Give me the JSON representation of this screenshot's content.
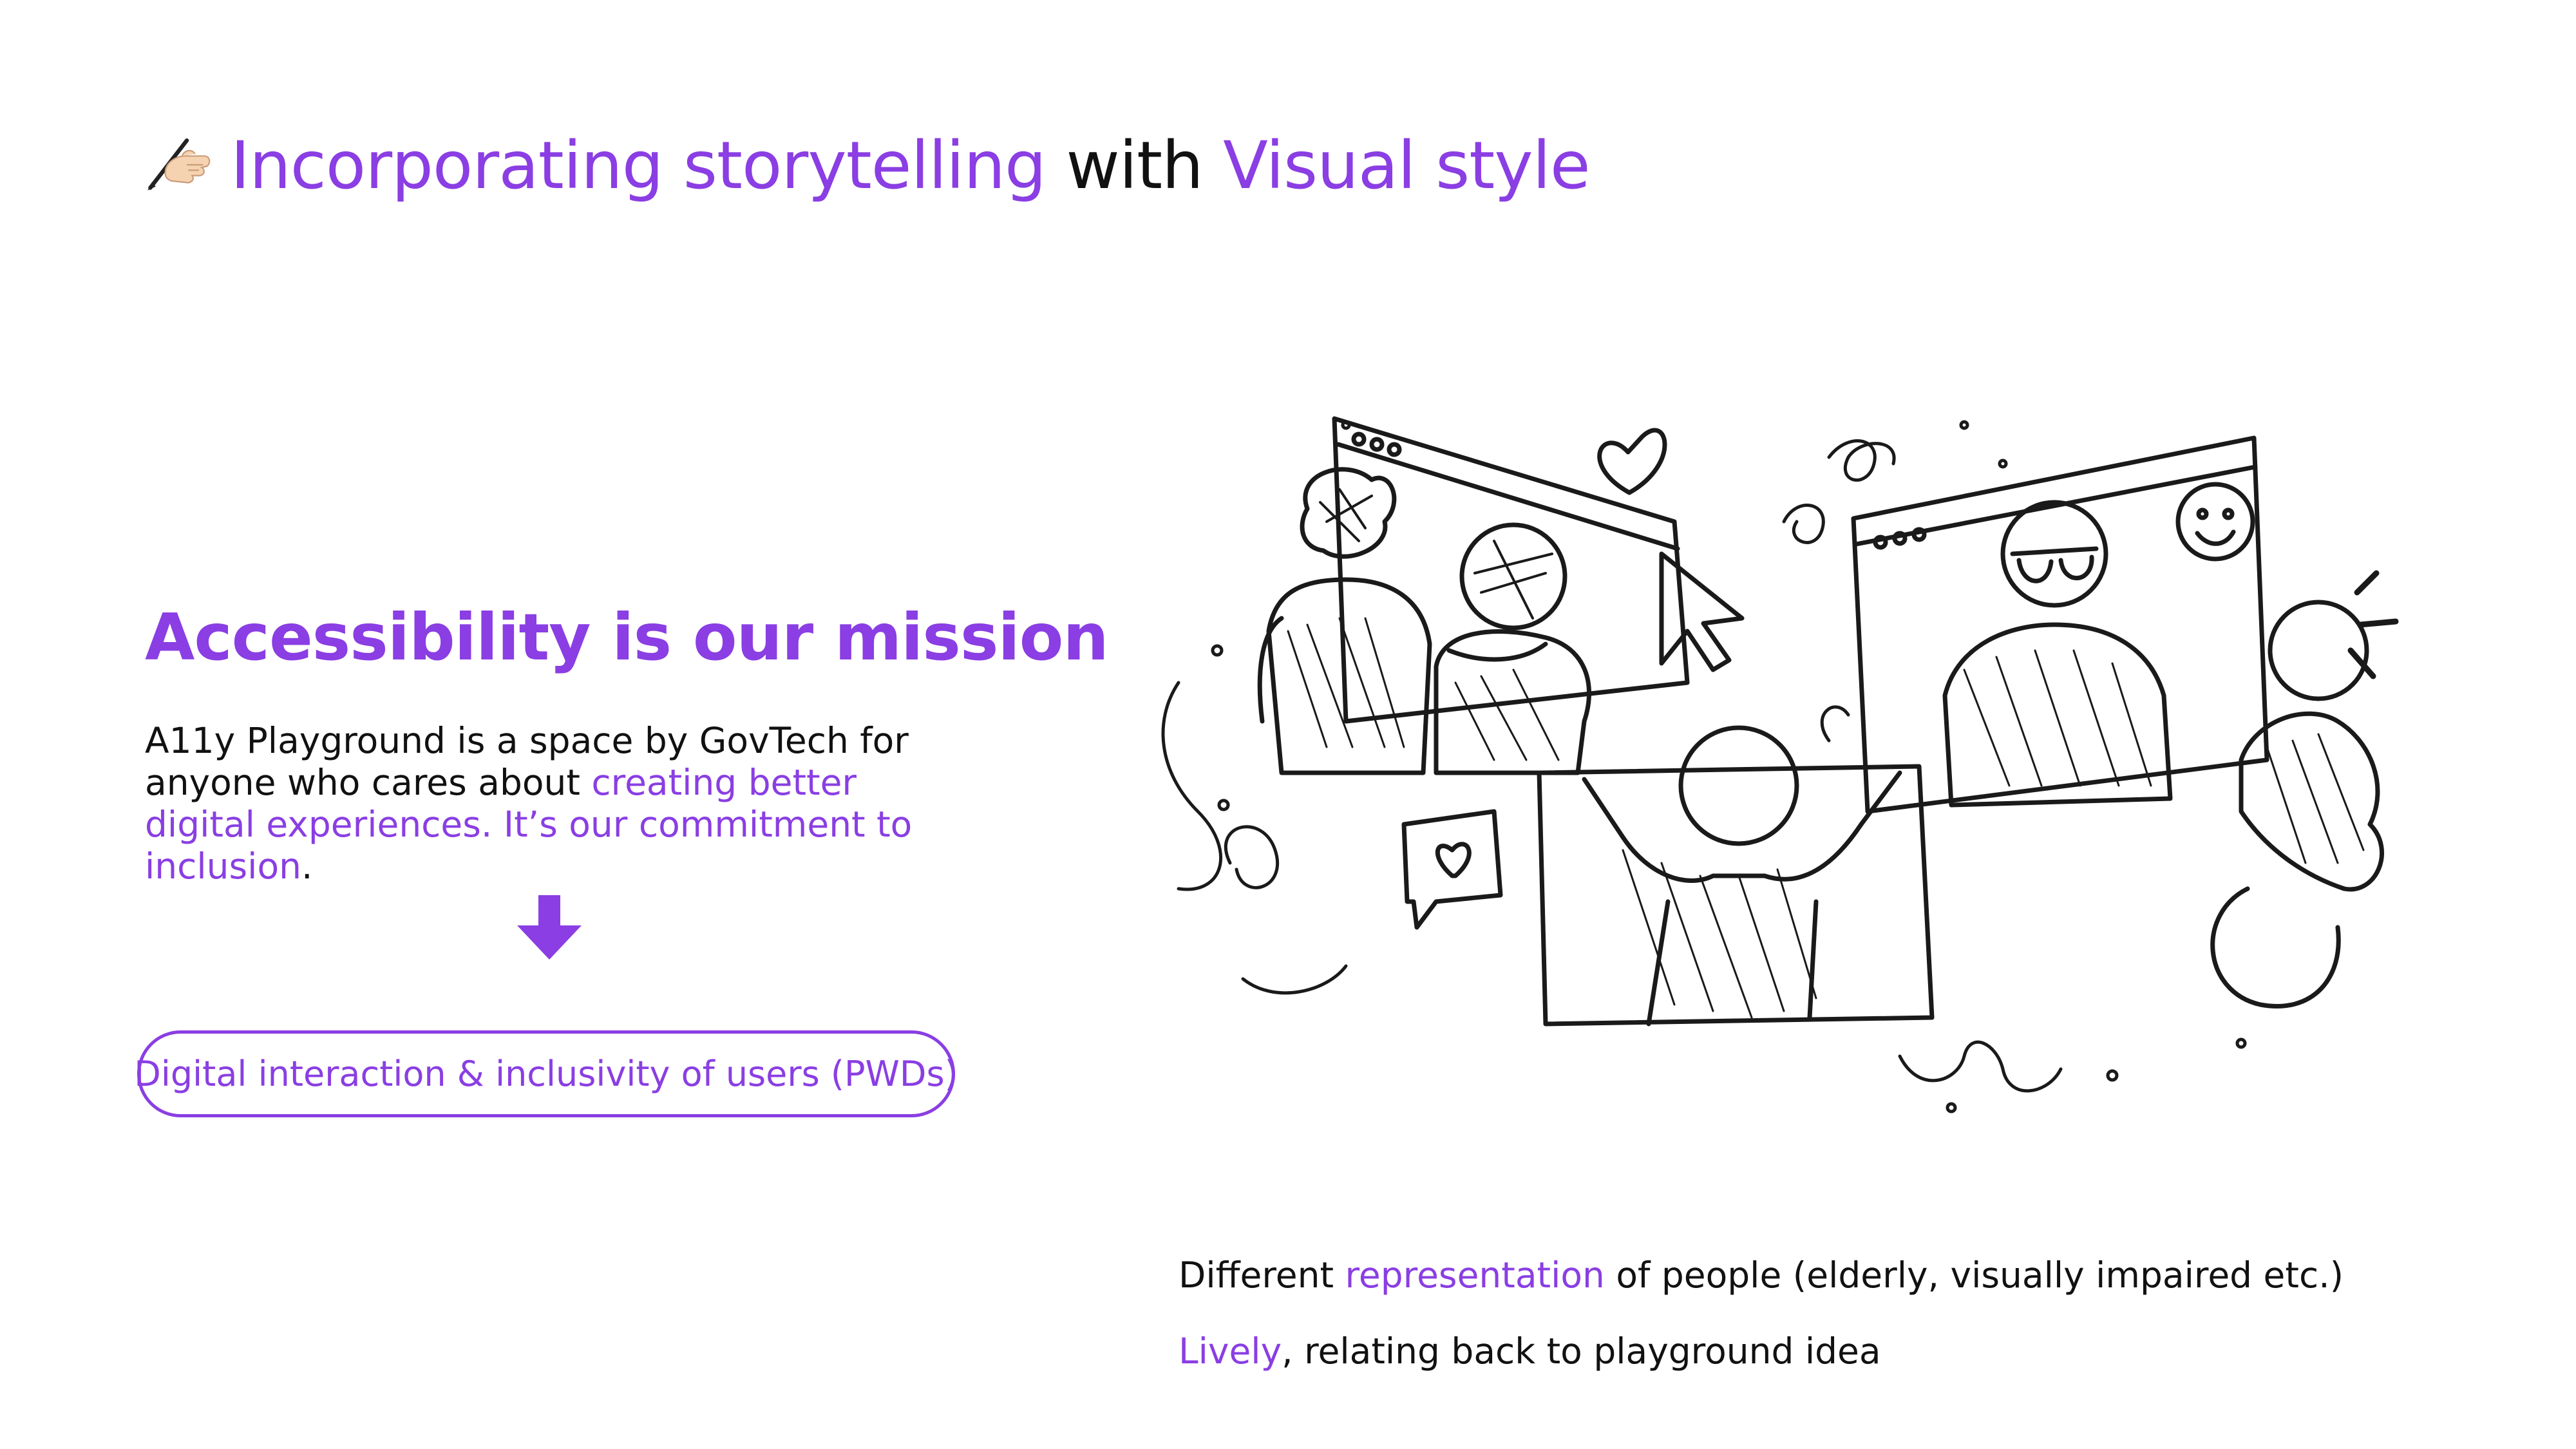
{
  "title": {
    "part1": "Incorporating storytelling",
    "part2": " with ",
    "part3": "Visual style",
    "emoji_icon": "writing-hand-icon"
  },
  "mission": {
    "heading": "Accessibility is our mission",
    "body_plain": "A11y Playground is a space by GovTech for anyone who cares about ",
    "body_highlight": "creating better digital experiences. It’s our commitment to inclusion",
    "body_end": "."
  },
  "arrow_icon": "arrow-down-icon",
  "pill": {
    "label": "Digital interaction & inclusivity of users (PWDs)"
  },
  "notes": {
    "line1_plain_a": "Different ",
    "line1_highlight": "representation",
    "line1_plain_b": " of people (elderly, visually impaired etc.)",
    "line2_highlight": "Lively",
    "line2_plain": ", relating back to playground idea"
  },
  "colors": {
    "accent": "#8a3ee3",
    "text": "#111111",
    "background": "#ffffff"
  }
}
